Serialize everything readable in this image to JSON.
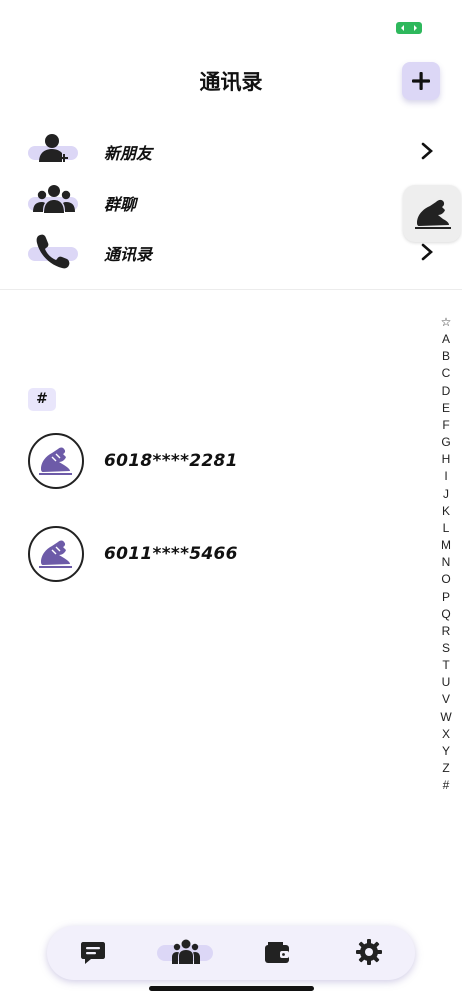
{
  "header": {
    "title": "通讯录"
  },
  "menu": [
    {
      "label": "新朋友",
      "icon": "add-user-icon",
      "has_chevron": true
    },
    {
      "label": "群聊",
      "icon": "group-icon",
      "has_chevron": false
    },
    {
      "label": "通讯录",
      "icon": "phone-icon",
      "has_chevron": true
    }
  ],
  "section": {
    "label": "#"
  },
  "contacts": [
    {
      "name": "6018****2281",
      "avatar": "sneaker-logo-icon"
    },
    {
      "name": "6011****5466",
      "avatar": "sneaker-logo-icon"
    }
  ],
  "index_letters": [
    "☆",
    "A",
    "B",
    "C",
    "D",
    "E",
    "F",
    "G",
    "H",
    "I",
    "J",
    "K",
    "L",
    "M",
    "N",
    "O",
    "P",
    "Q",
    "R",
    "S",
    "T",
    "U",
    "V",
    "W",
    "X",
    "Y",
    "Z",
    "#"
  ],
  "tabs": [
    {
      "name": "chat-icon",
      "active": false
    },
    {
      "name": "contacts-icon",
      "active": true
    },
    {
      "name": "wallet-icon",
      "active": false
    },
    {
      "name": "settings-icon",
      "active": false
    }
  ],
  "colors": {
    "accent": "#dcd7f6",
    "logo_purple": "#6d5ba8",
    "battery": "#2eb85c"
  }
}
